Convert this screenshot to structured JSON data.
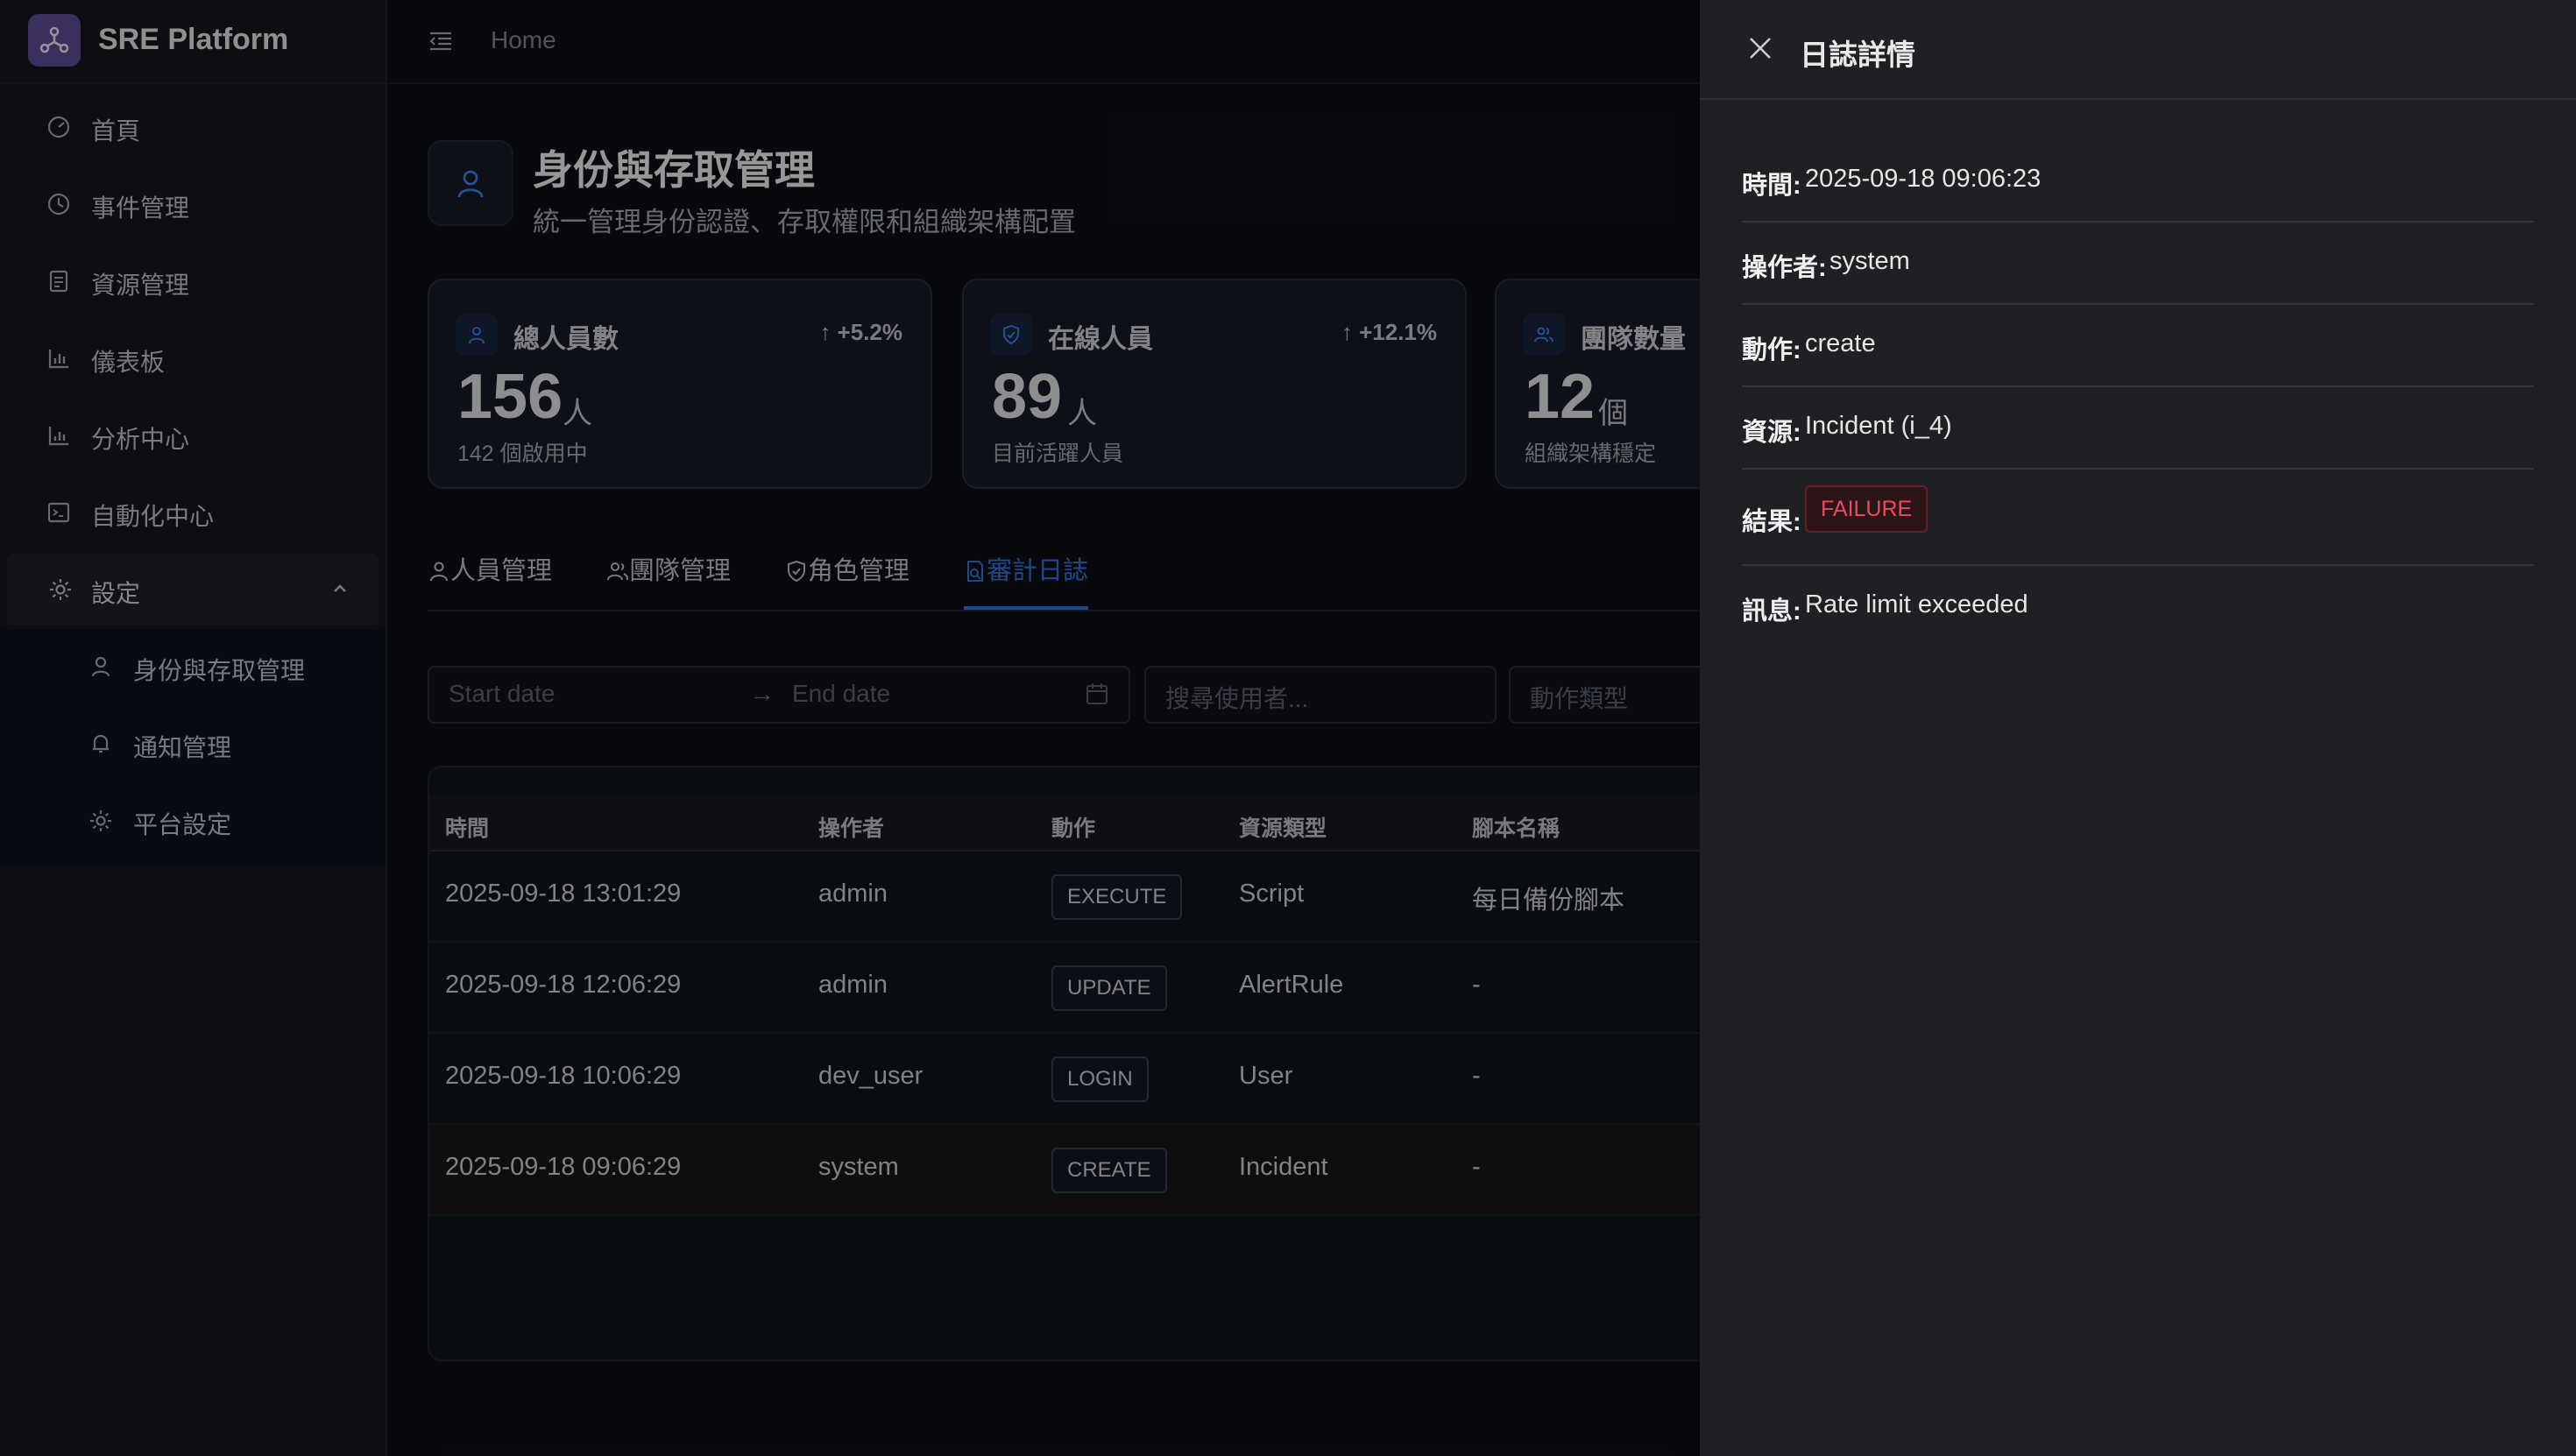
{
  "app": {
    "name": "SRE Platform"
  },
  "sidebar": {
    "items": [
      {
        "label": "首頁",
        "icon": "dashboard-gauge-icon"
      },
      {
        "label": "事件管理",
        "icon": "clock-icon"
      },
      {
        "label": "資源管理",
        "icon": "database-icon"
      },
      {
        "label": "儀表板",
        "icon": "bar-chart-icon"
      },
      {
        "label": "分析中心",
        "icon": "line-chart-icon"
      },
      {
        "label": "自動化中心",
        "icon": "terminal-icon"
      }
    ],
    "settings": {
      "label": "設定",
      "icon": "gear-icon"
    },
    "submenu": [
      {
        "label": "身份與存取管理",
        "icon": "user-icon"
      },
      {
        "label": "通知管理",
        "icon": "bell-icon"
      },
      {
        "label": "平台設定",
        "icon": "gear-icon"
      }
    ]
  },
  "header": {
    "breadcrumb": "Home"
  },
  "page": {
    "title": "身份與存取管理",
    "subtitle": "統一管理身份認證、存取權限和組織架構配置"
  },
  "stats": [
    {
      "title": "總人員數",
      "trend": "+5.2%",
      "value": "156",
      "unit": "人",
      "note": "142 個啟用中"
    },
    {
      "title": "在線人員",
      "trend": "+12.1%",
      "value": "89",
      "unit": "人",
      "note": "目前活躍人員"
    },
    {
      "title": "團隊數量",
      "trend": "",
      "value": "12",
      "unit": "個",
      "note": "組織架構穩定"
    }
  ],
  "tabs": [
    {
      "label": "人員管理"
    },
    {
      "label": "團隊管理"
    },
    {
      "label": "角色管理"
    },
    {
      "label": "審計日誌"
    }
  ],
  "active_tab": "審計日誌",
  "filters": {
    "start_date_placeholder": "Start date",
    "end_date_placeholder": "End date",
    "user_search_placeholder": "搜尋使用者...",
    "action_type_placeholder": "動作類型"
  },
  "table": {
    "columns": [
      "時間",
      "操作者",
      "動作",
      "資源類型",
      "腳本名稱"
    ],
    "rows": [
      {
        "time": "2025-09-18 13:01:29",
        "operator": "admin",
        "action": "EXECUTE",
        "resource": "Script",
        "script": "每日備份腳本"
      },
      {
        "time": "2025-09-18 12:06:29",
        "operator": "admin",
        "action": "UPDATE",
        "resource": "AlertRule",
        "script": "-"
      },
      {
        "time": "2025-09-18 10:06:29",
        "operator": "dev_user",
        "action": "LOGIN",
        "resource": "User",
        "script": "-"
      },
      {
        "time": "2025-09-18 09:06:29",
        "operator": "system",
        "action": "CREATE",
        "resource": "Incident",
        "script": "-"
      }
    ]
  },
  "drawer": {
    "title": "日誌詳情",
    "fields": [
      {
        "label": "時間:",
        "value": "2025-09-18 09:06:23"
      },
      {
        "label": "操作者:",
        "value": "system"
      },
      {
        "label": "動作:",
        "value": "create"
      },
      {
        "label": "資源:",
        "value": "Incident (i_4)"
      },
      {
        "label": "結果:",
        "value": "FAILURE"
      },
      {
        "label": "訊息:",
        "value": "Rate limit exceeded"
      }
    ]
  },
  "colors": {
    "accent": "#2f6fd8",
    "failure": "#ea4d5a",
    "highlight_row": "#1a1417"
  }
}
